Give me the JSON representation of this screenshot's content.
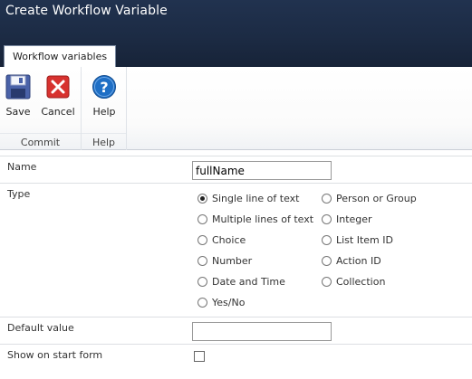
{
  "window": {
    "title": "Create Workflow Variable"
  },
  "ribbon": {
    "tab_label": "Workflow variables",
    "groups": {
      "commit": {
        "label": "Commit",
        "save_label": "Save",
        "cancel_label": "Cancel"
      },
      "help": {
        "label": "Help",
        "help_label": "Help"
      }
    }
  },
  "form": {
    "name": {
      "label": "Name",
      "value": "fullName"
    },
    "type": {
      "label": "Type",
      "selected": "Single line of text",
      "options_col1": [
        "Single line of text",
        "Multiple lines of text",
        "Choice",
        "Number",
        "Date and Time",
        "Yes/No"
      ],
      "options_col2": [
        "Person or Group",
        "Integer",
        "List Item ID",
        "Action ID",
        "Collection"
      ]
    },
    "default_value": {
      "label": "Default value",
      "value": ""
    },
    "show_on_start_form": {
      "label": "Show on start form",
      "checked": false
    }
  },
  "colors": {
    "title_bar": "#1c2b44",
    "accent_blue": "#1f6fc5",
    "cancel_red": "#d7322f"
  }
}
